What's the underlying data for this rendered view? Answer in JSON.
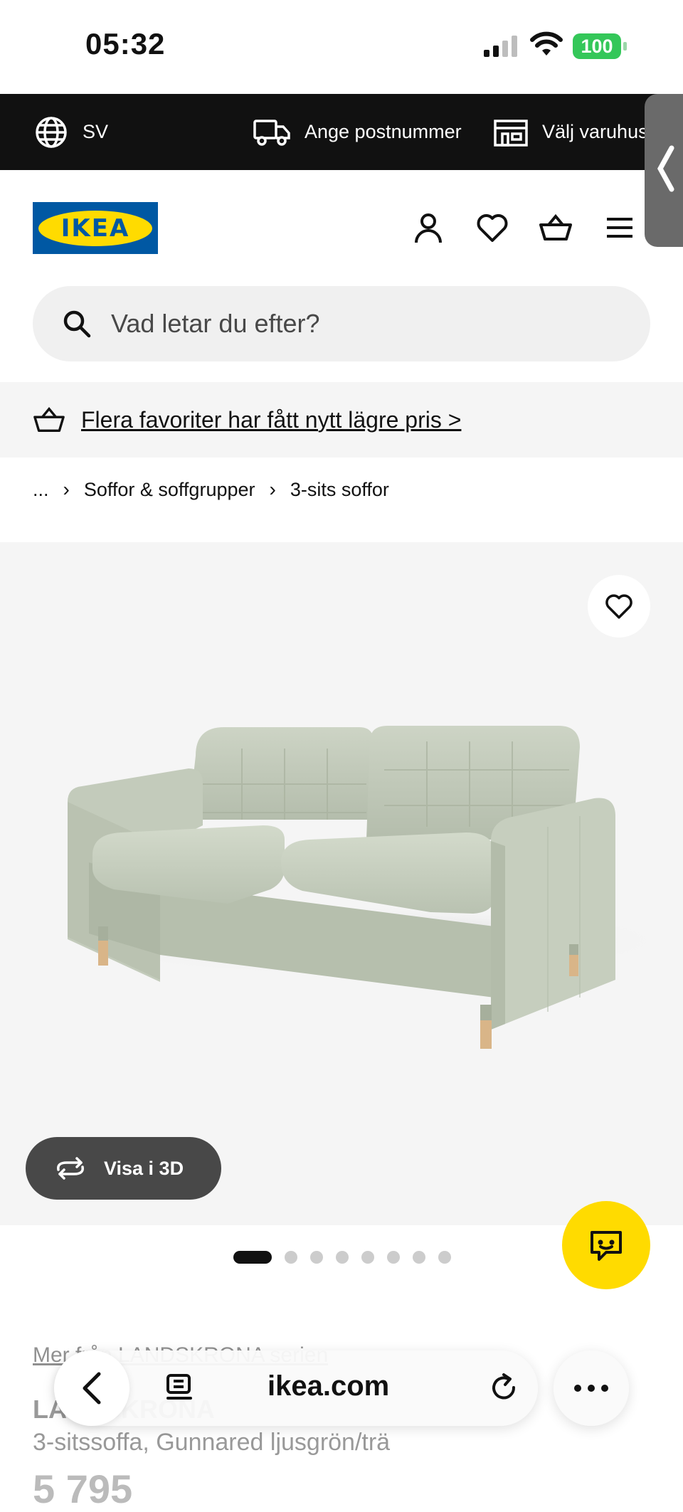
{
  "status_bar": {
    "time": "05:32",
    "battery": "100"
  },
  "top_bar": {
    "language": "SV",
    "postcode_label": "Ange postnummer",
    "store_label": "Välj varuhus"
  },
  "header": {
    "logo_text": "IKEA"
  },
  "search": {
    "placeholder": "Vad letar du efter?"
  },
  "promo": {
    "text": "Flera favoriter har fått nytt lägre pris >"
  },
  "breadcrumb": {
    "ellipsis": "...",
    "items": [
      "Soffor & soffgrupper",
      "3-sits soffor"
    ]
  },
  "product_image": {
    "view_3d_label": "Visa i 3D",
    "dot_count": 8,
    "active_dot": 1
  },
  "product": {
    "more_from": "Mer från LANDSKRONA serien",
    "name": "LANDSKRONA",
    "description": "3-sitssoffa, Gunnared ljusgrön/trä",
    "price": "5 795"
  },
  "browser": {
    "url": "ikea.com"
  },
  "colors": {
    "ikea_blue": "#0058a3",
    "ikea_yellow": "#ffdb00",
    "topbar_bg": "#111111",
    "sofa_green": "#c8d0c0"
  }
}
